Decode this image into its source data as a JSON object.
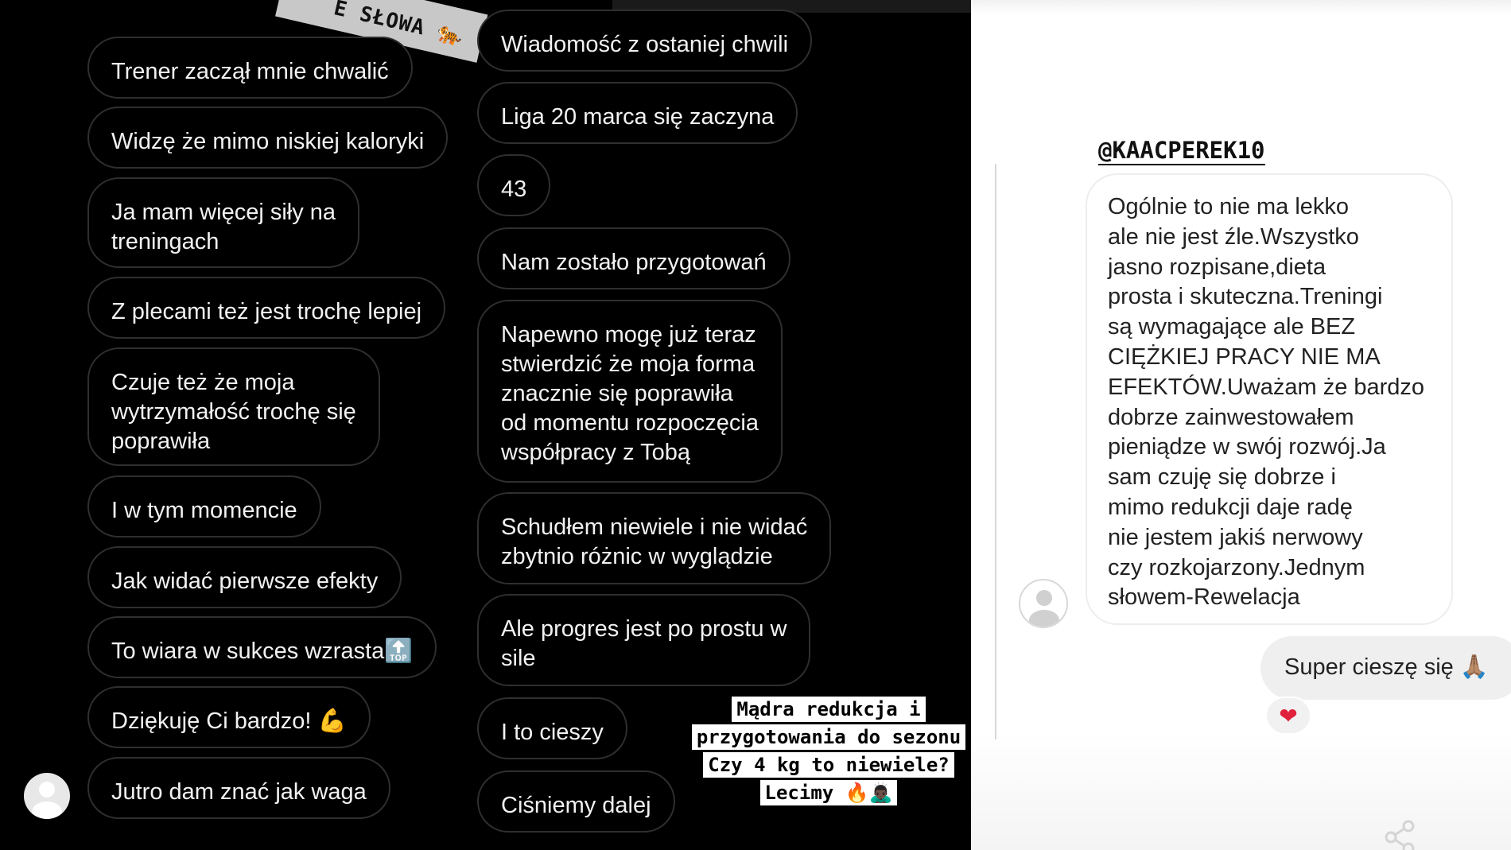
{
  "left_panel": {
    "banner_text": "E SŁOWA",
    "banner_emoji": "🐅",
    "column1": [
      "Trener zaczął mnie chwalić",
      "Widzę że mimo niskiej kaloryki",
      "Ja mam więcej siły na\ntreningach",
      "Z plecami też jest trochę lepiej",
      "Czuje też że moja\nwytrzymałość trochę się\npoprawiła",
      "I w tym momencie",
      "Jak widać pierwsze efekty",
      "To wiara w sukces wzrasta🔝",
      "Dziękuję Ci bardzo! 💪",
      "Jutro dam znać jak waga"
    ],
    "column2": [
      "Wiadomość z ostaniej chwili",
      "Liga 20 marca się zaczyna",
      "43",
      "Nam zostało przygotowań",
      "Napewno mogę już teraz\nstwierdzić że moja forma\nznacznie się poprawiła\nod momentu rozpoczęcia\nwspółpracy z Tobą",
      "Schudłem niewiele i nie widać\nzbytnio różnic w wyglądzie",
      "Ale progres jest po prostu w\nsile",
      "I to cieszy",
      "Ciśniemy dalej"
    ],
    "caption_lines": [
      "Mądra redukcja i",
      "przygotowania do sezonu",
      "Czy 4 kg to niewiele?",
      "Lecimy 🔥🙇🏿‍♂️"
    ]
  },
  "right_panel": {
    "handle": "@KAACPEREK10",
    "received_message": "Ogólnie to nie ma lekko\nale nie jest źle.Wszystko\njasno rozpisane,dieta\nprosta i skuteczna.Treningi\nsą wymagające ale BEZ\nCIĘŻKIEJ PRACY NIE MA\nEFEKTÓW.Uważam że bardzo\ndobrze zainwestowałem\npieniądze w swój rozwój.Ja\nsam czuję się dobrze i\nmimo redukcji daje radę\nnie jestem jakiś nerwowy\nczy rozkojarzony.Jednym\nsłowem-Rewelacja",
    "sent_message": "Super cieszę się 🙏🏽",
    "reaction": "❤"
  },
  "colors": {
    "left_background": "#000000",
    "bubble_border": "#2f2f2f",
    "right_background": "#ffffff",
    "sent_bubble": "#efefef",
    "heart": "#e0213b"
  },
  "icons": [
    "user-avatar-icon",
    "share-icon",
    "heart-icon"
  ]
}
